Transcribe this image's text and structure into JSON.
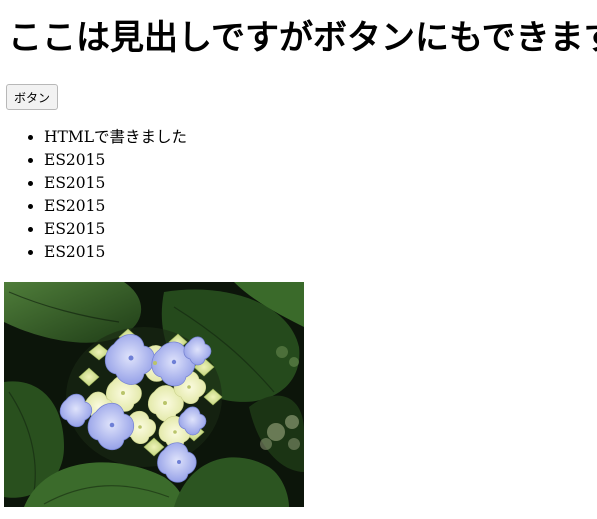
{
  "heading": "ここは見出しですがボタンにもできます",
  "button": {
    "label": "ボタン"
  },
  "list": {
    "items": [
      "HTMLで書きました",
      "ES2015",
      "ES2015",
      "ES2015",
      "ES2015",
      "ES2015"
    ]
  },
  "image": {
    "subject": "hydrangea-flower",
    "colors": {
      "leaf_dark": "#14240f",
      "leaf": "#2f5a22",
      "leaf_light": "#4f7d3a",
      "petal_blue": "#a9b3f0",
      "petal_cream": "#eef0b6",
      "petal_green": "#d4e393"
    }
  }
}
